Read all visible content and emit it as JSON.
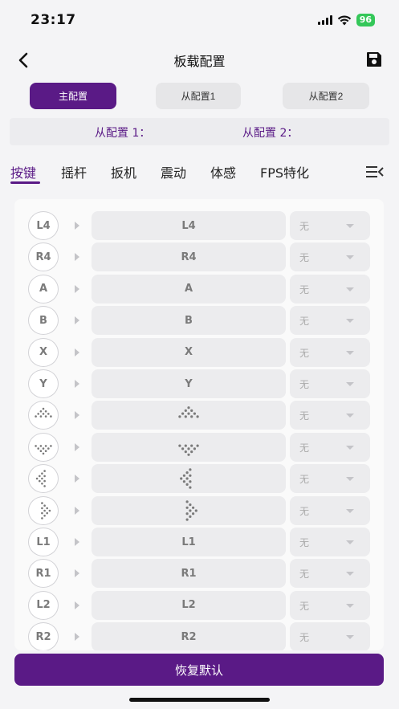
{
  "status": {
    "time": "23:17",
    "battery": "96"
  },
  "nav": {
    "title": "板载配置"
  },
  "configs": {
    "main": "主配置",
    "sub1": "从配置1",
    "sub2": "从配置2"
  },
  "config_info": {
    "sub1_label": "从配置 1：",
    "sub2_label": "从配置 2："
  },
  "tabs": [
    "按键",
    "摇杆",
    "扳机",
    "震动",
    "体感",
    "FPS特化"
  ],
  "active_tab": 0,
  "mapping_rows": [
    {
      "label": "L4",
      "key": "L4",
      "value": "无"
    },
    {
      "label": "R4",
      "key": "R4",
      "value": "无"
    },
    {
      "label": "A",
      "key": "A",
      "value": "无"
    },
    {
      "label": "B",
      "key": "B",
      "value": "无"
    },
    {
      "label": "X",
      "key": "X",
      "value": "无"
    },
    {
      "label": "Y",
      "key": "Y",
      "value": "无"
    },
    {
      "icon": "dpad-up-icon",
      "value": "无"
    },
    {
      "icon": "dpad-down-icon",
      "value": "无"
    },
    {
      "icon": "dpad-left-icon",
      "value": "无"
    },
    {
      "icon": "dpad-right-icon",
      "value": "无"
    },
    {
      "label": "L1",
      "key": "L1",
      "value": "无"
    },
    {
      "label": "R1",
      "key": "R1",
      "value": "无"
    },
    {
      "label": "L2",
      "key": "L2",
      "value": "无"
    },
    {
      "label": "R2",
      "key": "R2",
      "value": "无"
    }
  ],
  "reset_label": "恢复默认",
  "colors": {
    "accent": "#5a1a86",
    "battery": "#34c759",
    "background": "#f4f4f6"
  }
}
